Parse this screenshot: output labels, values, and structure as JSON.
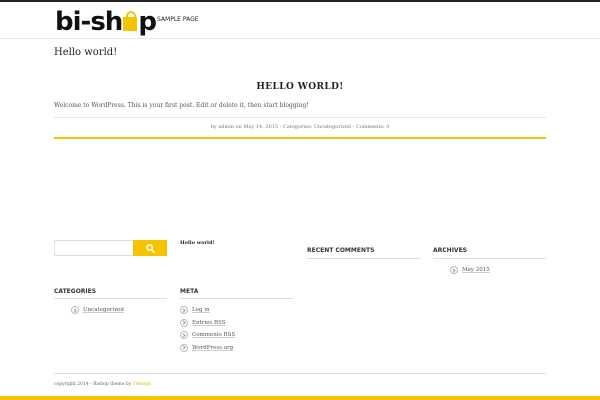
{
  "header": {
    "logo_left": "bi-sh",
    "logo_right": "p",
    "nav": [
      "SAMPLE PAGE"
    ]
  },
  "page_title": "Hello world!",
  "post": {
    "title": "HELLO WORLD!",
    "body": "Welcome to WordPress. This is your first post. Edit or delete it, then start blogging!",
    "meta": {
      "by": "by",
      "author": "admin",
      "on": "on",
      "date": "May 14, 2015",
      "sep1": "-",
      "categories_label": "Categories:",
      "category": "Uncategorized",
      "sep2": "-",
      "comments": "Comments: 0"
    }
  },
  "sidebar": {
    "search": {
      "placeholder": "",
      "icon": "search-icon"
    },
    "recent_posts": [
      "Hello world!"
    ],
    "recent_comments": {
      "title": "RECENT COMMENTS"
    },
    "archives": {
      "title": "ARCHIVES",
      "items": [
        "May 2015"
      ]
    },
    "categories": {
      "title": "CATEGORIES",
      "items": [
        "Uncategorized"
      ]
    },
    "meta": {
      "title": "META",
      "items": [
        "Log in",
        "Entries RSS",
        "Comments RSS",
        "WordPress.org"
      ]
    }
  },
  "footer": {
    "text": "copyright 2014 - Bishop theme by ",
    "link": "Vdesign"
  },
  "colors": {
    "accent": "#f5c400",
    "text": "#555555",
    "dark": "#222222"
  }
}
